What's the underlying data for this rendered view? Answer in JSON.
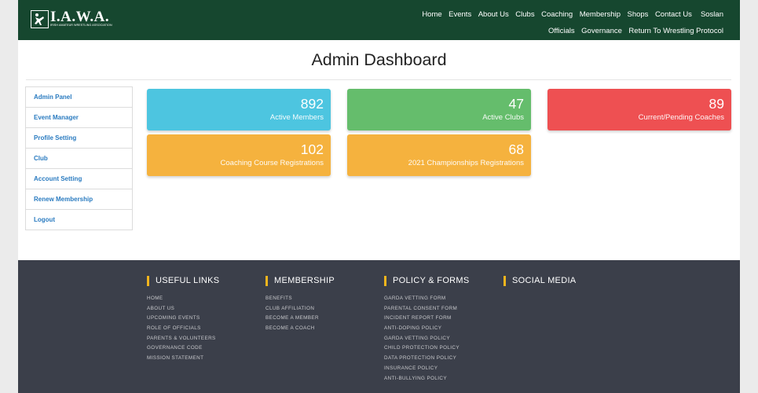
{
  "header": {
    "logo_text": "I.A.W.A.",
    "logo_subtext": "IRISH AMATEUR WRESTLING ASSOCIATION",
    "nav_row1": [
      "Home",
      "Events",
      "About Us",
      "Clubs",
      "Coaching",
      "Membership",
      "Shops",
      "Contact Us"
    ],
    "user_name": "Soslan",
    "nav_row2": [
      "Officials",
      "Governance",
      "Return To Wrestling Protocol"
    ]
  },
  "page_title": "Admin Dashboard",
  "sidebar": {
    "items": [
      "Admin Panel",
      "Event Manager",
      "Profile Setting",
      "Club",
      "Account Setting",
      "Renew Membership",
      "Logout"
    ]
  },
  "cards": [
    {
      "value": "892",
      "label": "Active Members",
      "color": "#4dc5e0"
    },
    {
      "value": "47",
      "label": "Active Clubs",
      "color": "#65bd6c"
    },
    {
      "value": "89",
      "label": "Current/Pending Coaches",
      "color": "#ee5052"
    },
    {
      "value": "102",
      "label": "Coaching Course Registrations",
      "color": "#f5b23e"
    },
    {
      "value": "68",
      "label": "2021 Championships Registrations",
      "color": "#f5b23e"
    }
  ],
  "footer": {
    "columns": [
      {
        "heading": "USEFUL LINKS",
        "links": [
          "HOME",
          "ABOUT US",
          "UPCOMING EVENTS",
          "ROLE OF OFFICIALS",
          "PARENTS & VOLUNTEERS",
          "GOVERNANCE CODE",
          "MISSION STATEMENT"
        ]
      },
      {
        "heading": "MEMBERSHIP",
        "links": [
          "BENEFITS",
          "CLUB AFFILIATION",
          "BECOME A MEMBER",
          "BECOME A COACH"
        ]
      },
      {
        "heading": "POLICY & FORMS",
        "links": [
          "GARDA VETTING FORM",
          "PARENTAL CONSENT FORM",
          "INCIDENT REPORT FORM",
          "ANTI-DOPING POLICY",
          "GARDA VETTING POLICY",
          "CHILD PROTECTION POLICY",
          "DATA PROTECTION POLICY",
          "INSURANCE POLICY",
          "ANTI-BULLYING POLICY"
        ]
      },
      {
        "heading": "SOCIAL MEDIA",
        "links": []
      }
    ]
  },
  "colors": {
    "header_bg": "#16472f",
    "footer_bg": "#3b3f4a",
    "accent_bar": "#f2b51d",
    "link_blue": "#2a7bc0"
  }
}
